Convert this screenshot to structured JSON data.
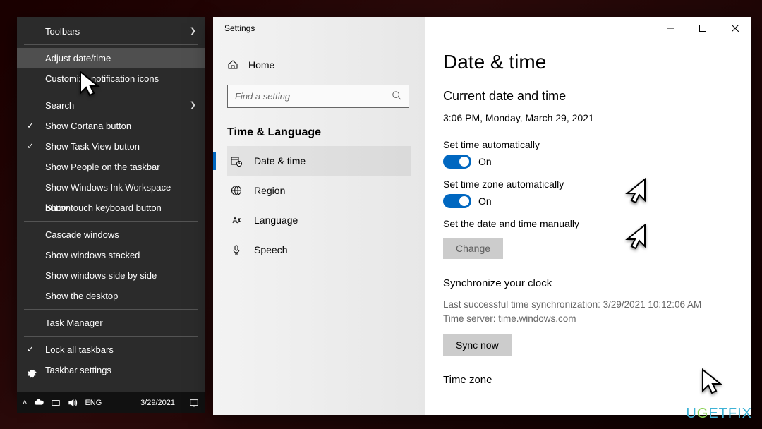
{
  "ctx": {
    "toolbars": "Toolbars",
    "adjust": "Adjust date/time",
    "customize": "Customize notification icons",
    "search": "Search",
    "cortana": "Show Cortana button",
    "taskview": "Show Task View button",
    "people": "Show People on the taskbar",
    "ink": "Show Windows Ink Workspace button",
    "touch": "Show touch keyboard button",
    "cascade": "Cascade windows",
    "stacked": "Show windows stacked",
    "sidebyside": "Show windows side by side",
    "desktop": "Show the desktop",
    "taskmgr": "Task Manager",
    "lock": "Lock all taskbars",
    "tbsettings": "Taskbar settings"
  },
  "tray": {
    "lang": "ENG",
    "date": "3/29/2021"
  },
  "settings": {
    "title": "Settings",
    "home": "Home",
    "search_placeholder": "Find a setting",
    "group": "Time & Language",
    "nav": {
      "datetime": "Date & time",
      "region": "Region",
      "language": "Language",
      "speech": "Speech"
    },
    "page": {
      "heading": "Date & time",
      "current_heading": "Current date and time",
      "current_value": "3:06 PM, Monday, March 29, 2021",
      "settime_label": "Set time automatically",
      "settime_state": "On",
      "settz_label": "Set time zone automatically",
      "settz_state": "On",
      "manual_label": "Set the date and time manually",
      "change_btn": "Change",
      "sync_heading": "Synchronize your clock",
      "sync_last": "Last successful time synchronization: 3/29/2021 10:12:06 AM",
      "sync_server": "Time server: time.windows.com",
      "sync_btn": "Sync now",
      "tz_heading": "Time zone"
    }
  },
  "watermark": "UGETFIX"
}
